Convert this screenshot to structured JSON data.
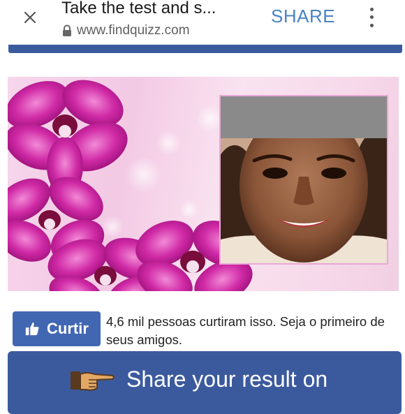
{
  "browser": {
    "title": "Take the test and s...",
    "url": "www.findquizz.com",
    "share_label": "SHARE"
  },
  "icons": {
    "close": "close-icon",
    "lock": "lock-icon",
    "menu": "more-vert-icon",
    "thumbs_up": "thumbs-up-icon",
    "pointing_hand": "pointing-hand-icon"
  },
  "like": {
    "button_label": "Curtir",
    "text": "4,6 mil pessoas curtiram isso. Seja o primeiro de seus amigos."
  },
  "result_button": {
    "label": "Share your result on"
  },
  "colors": {
    "facebook_blue": "#4267b2",
    "banner_blue": "#3b5a9e",
    "share_accent": "#4a82c4",
    "orchid_magenta": "#c2188e"
  }
}
